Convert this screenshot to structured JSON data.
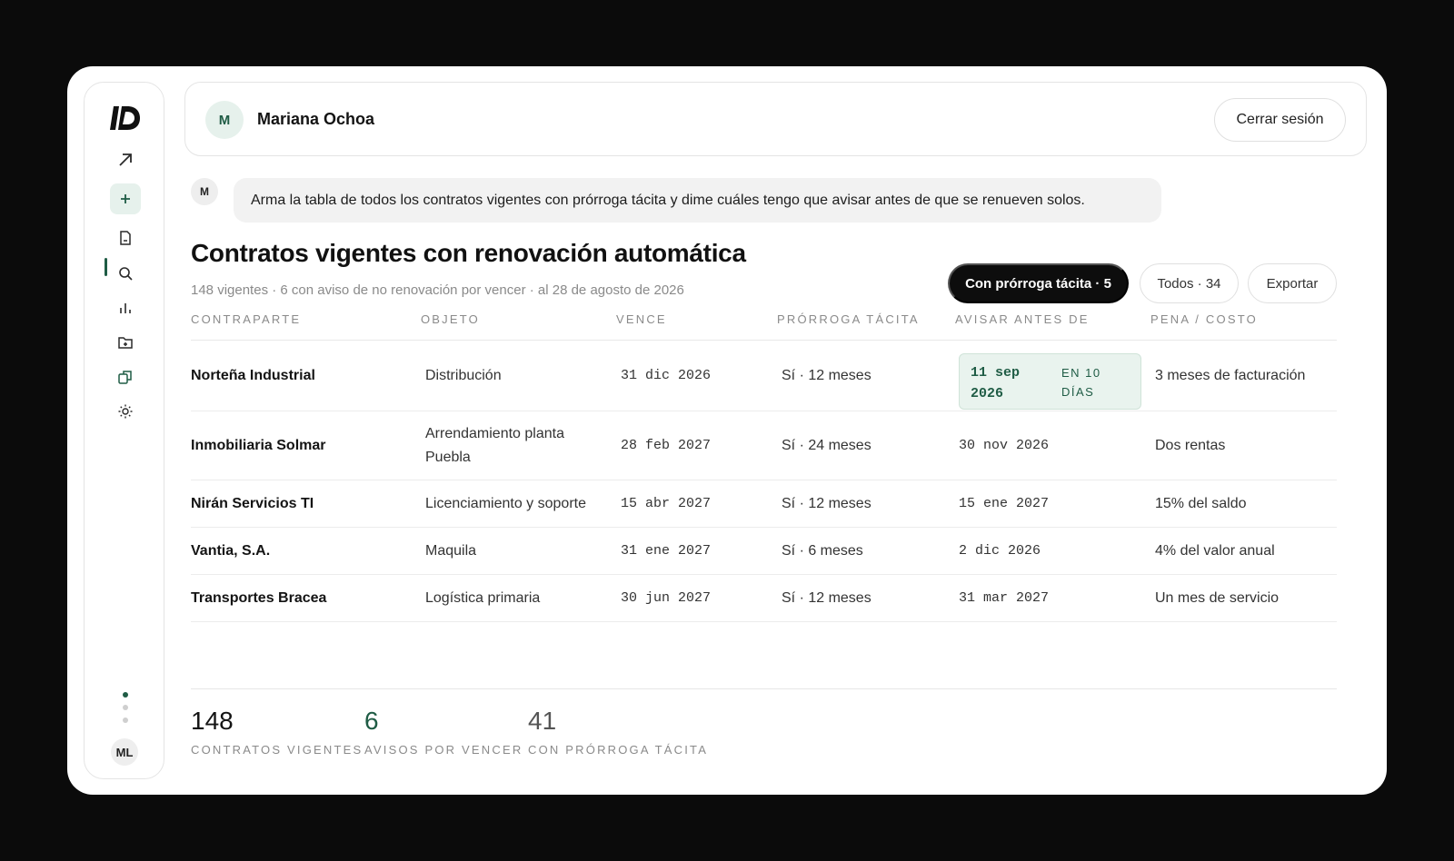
{
  "sidebar": {
    "logo": "brand-logo",
    "items": [
      {
        "name": "arrow-up-right-icon"
      },
      {
        "name": "plus-icon",
        "active": true
      },
      {
        "name": "document-icon"
      },
      {
        "name": "search-icon"
      },
      {
        "name": "bar-chart-icon"
      },
      {
        "name": "folder-plus-icon"
      },
      {
        "name": "copy-icon"
      },
      {
        "name": "sun-icon"
      }
    ],
    "user_initials": "ML"
  },
  "header": {
    "avatar_initial": "M",
    "user_name": "Mariana Ochoa",
    "logout_label": "Cerrar sesión"
  },
  "prompt": {
    "avatar_initial": "M",
    "text": "Arma la tabla de todos los contratos vigentes con prórroga tácita y dime cuáles tengo que avisar antes de que se renueven solos."
  },
  "report": {
    "title": "Contratos vigentes con renovación automática",
    "subtitle": "148 vigentes · 6 con aviso de no renovación por vencer · al 28 de agosto de 2026",
    "filters": {
      "primary": "Con prórroga tácita · 5",
      "all": "Todos · 34",
      "export": "Exportar"
    }
  },
  "table": {
    "headers": [
      "CONTRAPARTE",
      "OBJETO",
      "VENCE",
      "PRÓRROGA TÁCITA",
      "AVISAR ANTES DE",
      "PENA / COSTO"
    ],
    "rows": [
      {
        "party": "Norteña Industrial",
        "object": "Distribución",
        "expires": "31 dic 2026",
        "renewal": "Sí · 12 meses",
        "notice": "11 sep 2026",
        "notice_flag": "EN 10 DÍAS",
        "penalty": "3 meses de facturación"
      },
      {
        "party": "Inmobiliaria Solmar",
        "object": "Arrendamiento planta Puebla",
        "expires": "28 feb 2027",
        "renewal": "Sí · 24 meses",
        "notice": "30 nov 2026",
        "penalty": "Dos rentas"
      },
      {
        "party": "Nirán Servicios TI",
        "object": "Licenciamiento y soporte",
        "expires": "15 abr 2027",
        "renewal": "Sí · 12 meses",
        "notice": "15 ene 2027",
        "penalty": "15% del saldo"
      },
      {
        "party": "Vantia, S.A.",
        "object": "Maquila",
        "expires": "31 ene 2027",
        "renewal": "Sí · 6 meses",
        "notice": "2 dic 2026",
        "penalty": "4% del valor anual"
      },
      {
        "party": "Transportes Bracea",
        "object": "Logística primaria",
        "expires": "30 jun 2027",
        "renewal": "Sí · 12 meses",
        "notice": "31 mar 2027",
        "penalty": "Un mes de servicio"
      }
    ]
  },
  "stats": [
    {
      "value": "148",
      "label": "CONTRATOS VIGENTES"
    },
    {
      "value": "6",
      "label": "AVISOS POR VENCER"
    },
    {
      "value": "41",
      "label": "CON PRÓRROGA TÁCITA"
    }
  ],
  "colors": {
    "accent": "#1f5c45",
    "accent_bg": "#e6f1ec",
    "primary_pill": "#0d0d0d",
    "window_bg": "#ffffff",
    "backdrop": "#0b0b0b"
  }
}
